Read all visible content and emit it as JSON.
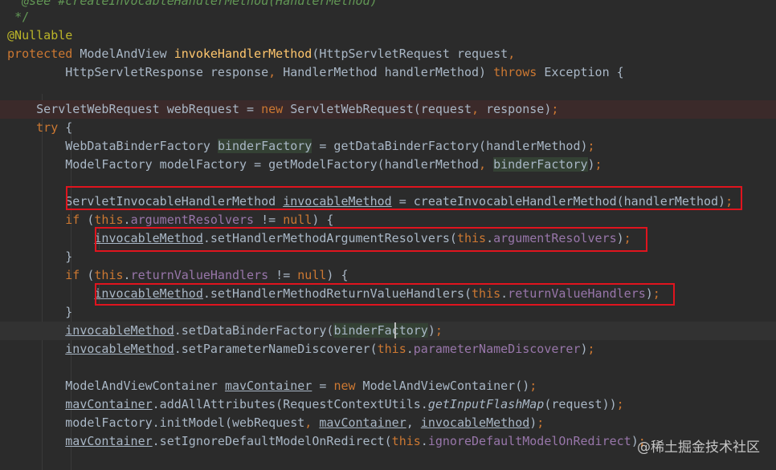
{
  "editor": {
    "lines": [
      [
        {
          "t": "   "
        },
        {
          "t": "@see",
          "c": "tok-cmt"
        },
        {
          "t": " #createInvocableHandlerMethod(HandlerMethod)",
          "c": "tok-cmt"
        }
      ],
      [
        {
          "t": "  "
        },
        {
          "t": "*/",
          "c": "tok-cmt-plain"
        }
      ],
      [
        {
          "t": " "
        },
        {
          "t": "@Nullable",
          "c": "tok-ann"
        }
      ],
      [
        {
          "t": " "
        },
        {
          "t": "protected",
          "c": "tok-kw"
        },
        {
          "t": " ModelAndView "
        },
        {
          "t": "invokeHandlerMethod",
          "c": "tok-fn"
        },
        {
          "t": "(HttpServletRequest request"
        },
        {
          "t": ",",
          "c": "tok-kw"
        }
      ],
      [
        {
          "t": "         HttpServletResponse response"
        },
        {
          "t": ",",
          "c": "tok-kw"
        },
        {
          "t": " HandlerMethod handlerMethod) "
        },
        {
          "t": "throws",
          "c": "tok-kw"
        },
        {
          "t": " Exception {"
        }
      ],
      [
        {
          "t": ""
        }
      ],
      [
        {
          "t": "     ServletWebRequest webRequest = "
        },
        {
          "t": "new",
          "c": "tok-kw"
        },
        {
          "t": " ServletWebRequest(request"
        },
        {
          "t": ",",
          "c": "tok-kw"
        },
        {
          "t": " response)"
        },
        {
          "t": ";",
          "c": "tok-kw"
        }
      ],
      [
        {
          "t": "     "
        },
        {
          "t": "try",
          "c": "tok-kw"
        },
        {
          "t": " {"
        }
      ],
      [
        {
          "t": "         WebDataBinderFactory "
        },
        {
          "t": "binderFactory",
          "c": "tok-hl"
        },
        {
          "t": " = getDataBinderFactory(handlerMethod)"
        },
        {
          "t": ";",
          "c": "tok-kw"
        }
      ],
      [
        {
          "t": "         ModelFactory modelFactory = getModelFactory(handlerMethod"
        },
        {
          "t": ",",
          "c": "tok-kw"
        },
        {
          "t": " "
        },
        {
          "t": "binderFactory",
          "c": "tok-hl"
        },
        {
          "t": ")"
        },
        {
          "t": ";",
          "c": "tok-kw"
        }
      ],
      [
        {
          "t": ""
        }
      ],
      [
        {
          "t": "         ServletInvocableHandlerMethod "
        },
        {
          "t": "invocableMethod",
          "c": "tok-var"
        },
        {
          "t": " = createInvocableHandlerMethod(handlerMethod)"
        },
        {
          "t": ";",
          "c": "tok-kw"
        }
      ],
      [
        {
          "t": "         "
        },
        {
          "t": "if",
          "c": "tok-kw"
        },
        {
          "t": " ("
        },
        {
          "t": "this",
          "c": "tok-kw"
        },
        {
          "t": "."
        },
        {
          "t": "argumentResolvers",
          "c": "tok-field"
        },
        {
          "t": " != "
        },
        {
          "t": "null",
          "c": "tok-kw"
        },
        {
          "t": ") {"
        }
      ],
      [
        {
          "t": "             "
        },
        {
          "t": "invocableMethod",
          "c": "tok-var"
        },
        {
          "t": ".setHandlerMethodArgumentResolvers("
        },
        {
          "t": "this",
          "c": "tok-kw"
        },
        {
          "t": "."
        },
        {
          "t": "argumentResolvers",
          "c": "tok-field"
        },
        {
          "t": ")"
        },
        {
          "t": ";",
          "c": "tok-kw"
        }
      ],
      [
        {
          "t": "         }"
        }
      ],
      [
        {
          "t": "         "
        },
        {
          "t": "if",
          "c": "tok-kw"
        },
        {
          "t": " ("
        },
        {
          "t": "this",
          "c": "tok-kw"
        },
        {
          "t": "."
        },
        {
          "t": "returnValueHandlers",
          "c": "tok-field"
        },
        {
          "t": " != "
        },
        {
          "t": "null",
          "c": "tok-kw"
        },
        {
          "t": ") {"
        }
      ],
      [
        {
          "t": "             "
        },
        {
          "t": "invocableMethod",
          "c": "tok-var"
        },
        {
          "t": ".setHandlerMethodReturnValueHandlers("
        },
        {
          "t": "this",
          "c": "tok-kw"
        },
        {
          "t": "."
        },
        {
          "t": "returnValueHandlers",
          "c": "tok-field"
        },
        {
          "t": ")"
        },
        {
          "t": ";",
          "c": "tok-kw"
        }
      ],
      [
        {
          "t": "         }"
        }
      ],
      [
        {
          "t": "         "
        },
        {
          "t": "invocableMethod",
          "c": "tok-var"
        },
        {
          "t": ".setDataBinderFactory("
        },
        {
          "t": "binderFactory",
          "c": "tok-hl"
        },
        {
          "t": ")"
        },
        {
          "t": ";",
          "c": "tok-kw"
        }
      ],
      [
        {
          "t": "         "
        },
        {
          "t": "invocableMethod",
          "c": "tok-var"
        },
        {
          "t": ".setParameterNameDiscoverer("
        },
        {
          "t": "this",
          "c": "tok-kw"
        },
        {
          "t": "."
        },
        {
          "t": "parameterNameDiscoverer",
          "c": "tok-field"
        },
        {
          "t": ")"
        },
        {
          "t": ";",
          "c": "tok-kw"
        }
      ],
      [
        {
          "t": ""
        }
      ],
      [
        {
          "t": "         ModelAndViewContainer "
        },
        {
          "t": "mavContainer",
          "c": "tok-var"
        },
        {
          "t": " = "
        },
        {
          "t": "new",
          "c": "tok-kw"
        },
        {
          "t": " ModelAndViewContainer()"
        },
        {
          "t": ";",
          "c": "tok-kw"
        }
      ],
      [
        {
          "t": "         "
        },
        {
          "t": "mavContainer",
          "c": "tok-var"
        },
        {
          "t": ".addAllAttributes(RequestContextUtils."
        },
        {
          "t": "getInputFlashMap",
          "c": "tok-ital"
        },
        {
          "t": "(request))"
        },
        {
          "t": ";",
          "c": "tok-kw"
        }
      ],
      [
        {
          "t": "         modelFactory.initModel(webRequest"
        },
        {
          "t": ",",
          "c": "tok-kw"
        },
        {
          "t": " "
        },
        {
          "t": "mavContainer",
          "c": "tok-var"
        },
        {
          "t": ","
        },
        {
          "t": " "
        },
        {
          "t": "invocableMethod",
          "c": "tok-var"
        },
        {
          "t": ")"
        },
        {
          "t": ";",
          "c": "tok-kw"
        }
      ],
      [
        {
          "t": "         "
        },
        {
          "t": "mavContainer",
          "c": "tok-var"
        },
        {
          "t": ".setIgnoreDefaultModelOnRedirect("
        },
        {
          "t": "this",
          "c": "tok-kw"
        },
        {
          "t": "."
        },
        {
          "t": "ignoreDefaultModelOnRedirect",
          "c": "tok-field"
        },
        {
          "t": ")"
        },
        {
          "t": ";",
          "c": "tok-kw"
        }
      ]
    ]
  },
  "watermark": "@稀土掘金技术社区"
}
